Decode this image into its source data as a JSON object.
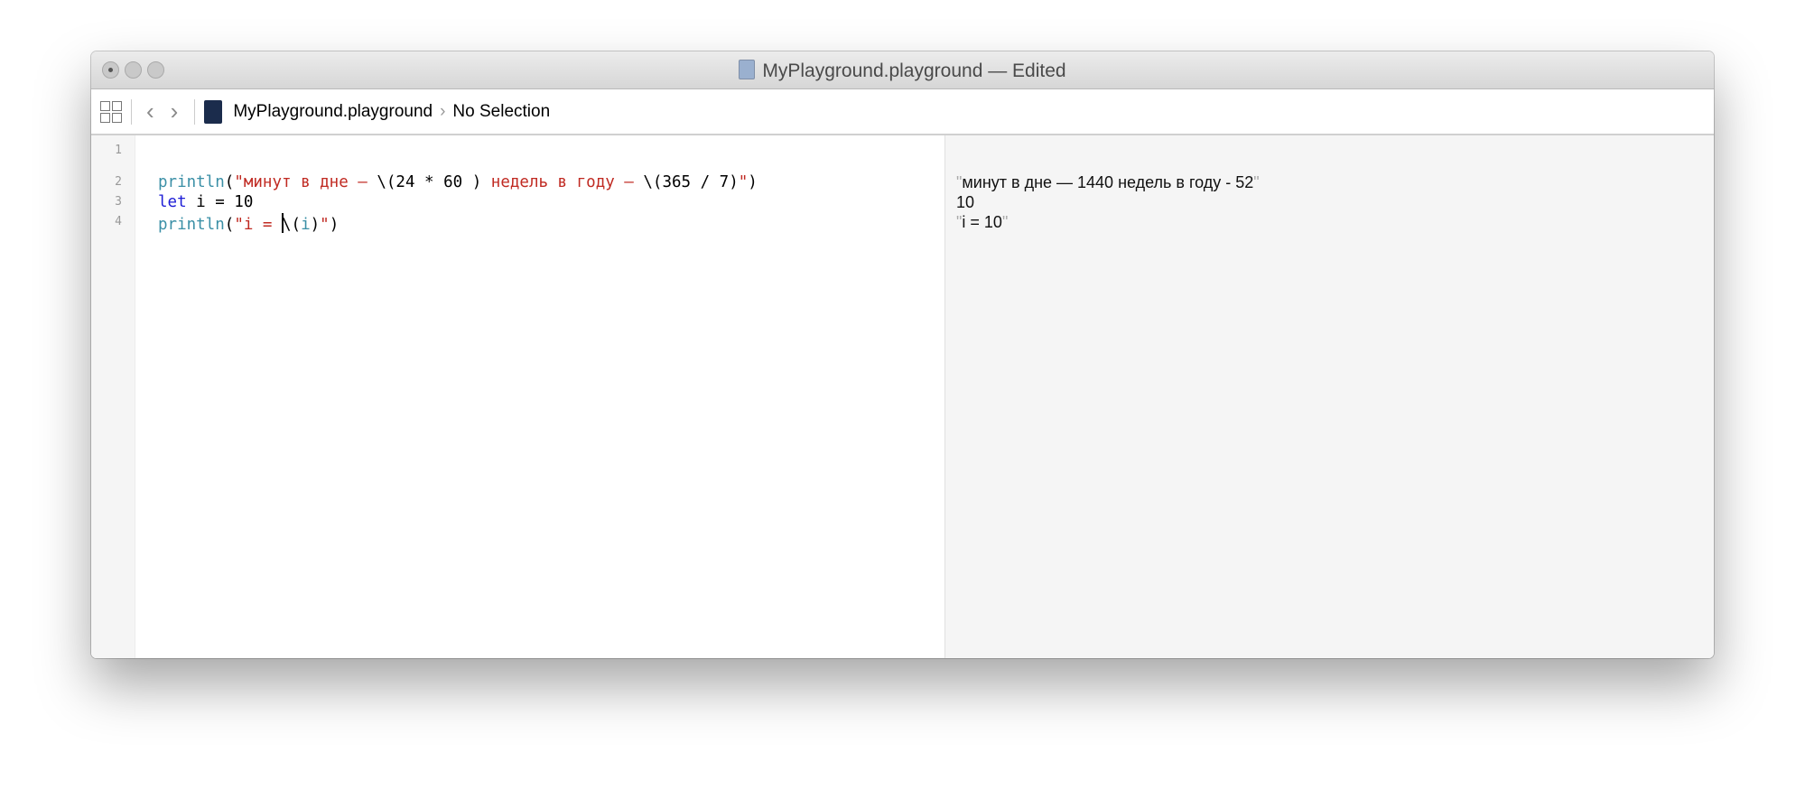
{
  "window": {
    "title": "MyPlayground.playground — Edited"
  },
  "toolbar": {
    "grid_icon": "grid-icon",
    "back": "‹",
    "forward": "›",
    "breadcrumb": {
      "file": "MyPlayground.playground",
      "separator": "›",
      "selection": "No Selection"
    }
  },
  "editor": {
    "line_numbers": [
      "1",
      "2",
      "3",
      "4"
    ],
    "lines": [
      [],
      [
        {
          "t": "println",
          "c": "fn"
        },
        {
          "t": "(",
          "c": ""
        },
        {
          "t": "\"минут в дне – ",
          "c": "str"
        },
        {
          "t": "\\(24 * 60 )",
          "c": ""
        },
        {
          "t": " недель в году – ",
          "c": "str"
        },
        {
          "t": "\\(365 / 7)",
          "c": ""
        },
        {
          "t": "\"",
          "c": "str"
        },
        {
          "t": ")",
          "c": ""
        }
      ],
      [
        {
          "t": "let",
          "c": "kw"
        },
        {
          "t": " i = 10",
          "c": ""
        }
      ],
      [
        {
          "t": "println",
          "c": "fn"
        },
        {
          "t": "(",
          "c": ""
        },
        {
          "t": "\"i = ",
          "c": "str"
        },
        {
          "t": "CARET",
          "c": "caret"
        },
        {
          "t": "\\(",
          "c": ""
        },
        {
          "t": "i",
          "c": "fn"
        },
        {
          "t": ")",
          "c": ""
        },
        {
          "t": "\"",
          "c": "str"
        },
        {
          "t": ")",
          "c": ""
        }
      ]
    ]
  },
  "results": [
    {
      "quoted": true,
      "text": "минут в дне — 1440 недель в году - 52",
      "line": 2
    },
    {
      "quoted": false,
      "text": "10",
      "line": 3
    },
    {
      "quoted": true,
      "text": "i = 10",
      "line": 4
    }
  ]
}
